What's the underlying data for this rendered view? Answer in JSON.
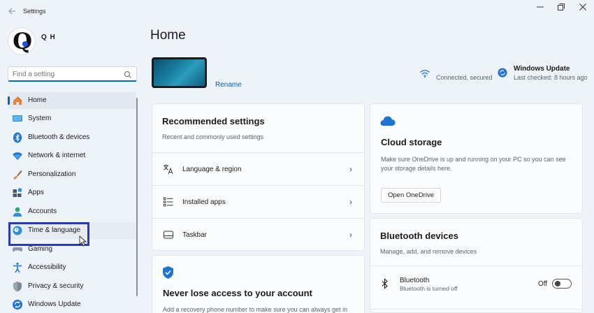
{
  "window": {
    "title": "Settings",
    "back_icon": "back-arrow-icon",
    "minimize_glyph": "—",
    "maximize_glyph": "❐",
    "close_glyph": "✕"
  },
  "profile": {
    "avatar_letter": "Q",
    "name": "Q H"
  },
  "search": {
    "placeholder": "Find a setting"
  },
  "sidebar": {
    "items": [
      {
        "label": "Home",
        "icon": "home-icon",
        "selected": true
      },
      {
        "label": "System",
        "icon": "system-display-icon"
      },
      {
        "label": "Bluetooth & devices",
        "icon": "bluetooth-icon"
      },
      {
        "label": "Network & internet",
        "icon": "wifi-icon"
      },
      {
        "label": "Personalization",
        "icon": "paintbrush-icon"
      },
      {
        "label": "Apps",
        "icon": "apps-icon"
      },
      {
        "label": "Accounts",
        "icon": "person-icon"
      },
      {
        "label": "Time & language",
        "icon": "globe-clock-icon",
        "hovered": true
      },
      {
        "label": "Gaming",
        "icon": "gamepad-icon"
      },
      {
        "label": "Accessibility",
        "icon": "accessibility-icon"
      },
      {
        "label": "Privacy & security",
        "icon": "shield-icon"
      },
      {
        "label": "Windows Update",
        "icon": "windows-update-icon"
      }
    ]
  },
  "main": {
    "title": "Home",
    "device": {
      "rename_label": "Rename"
    },
    "status": {
      "connection": "Connected, secured",
      "update_title": "Windows Update",
      "update_sub": "Last checked: 8 hours ago"
    },
    "recommended": {
      "title": "Recommended settings",
      "subtitle": "Recent and commonly used settings",
      "rows": [
        {
          "label": "Language & region",
          "icon": "language-icon"
        },
        {
          "label": "Installed apps",
          "icon": "list-icon"
        },
        {
          "label": "Taskbar",
          "icon": "taskbar-icon"
        }
      ],
      "chevron": "›"
    },
    "account": {
      "title": "Never lose access to your account",
      "subtitle": "Add a recovery phone number to make sure you can always get in"
    },
    "cloud": {
      "title": "Cloud storage",
      "description": "Make sure OneDrive is up and running on your PC so you can see your storage details here.",
      "button": "Open OneDrive"
    },
    "bluetooth": {
      "title": "Bluetooth devices",
      "subtitle": "Manage, add, and remove devices",
      "device_name": "Bluetooth",
      "device_state": "Bluetooth is turned off",
      "toggle_label": "Off",
      "toggle_on": false
    }
  },
  "colors": {
    "accent": "#0067c0",
    "highlight_box": "#2b3ab5",
    "background": "#eef3f9"
  }
}
